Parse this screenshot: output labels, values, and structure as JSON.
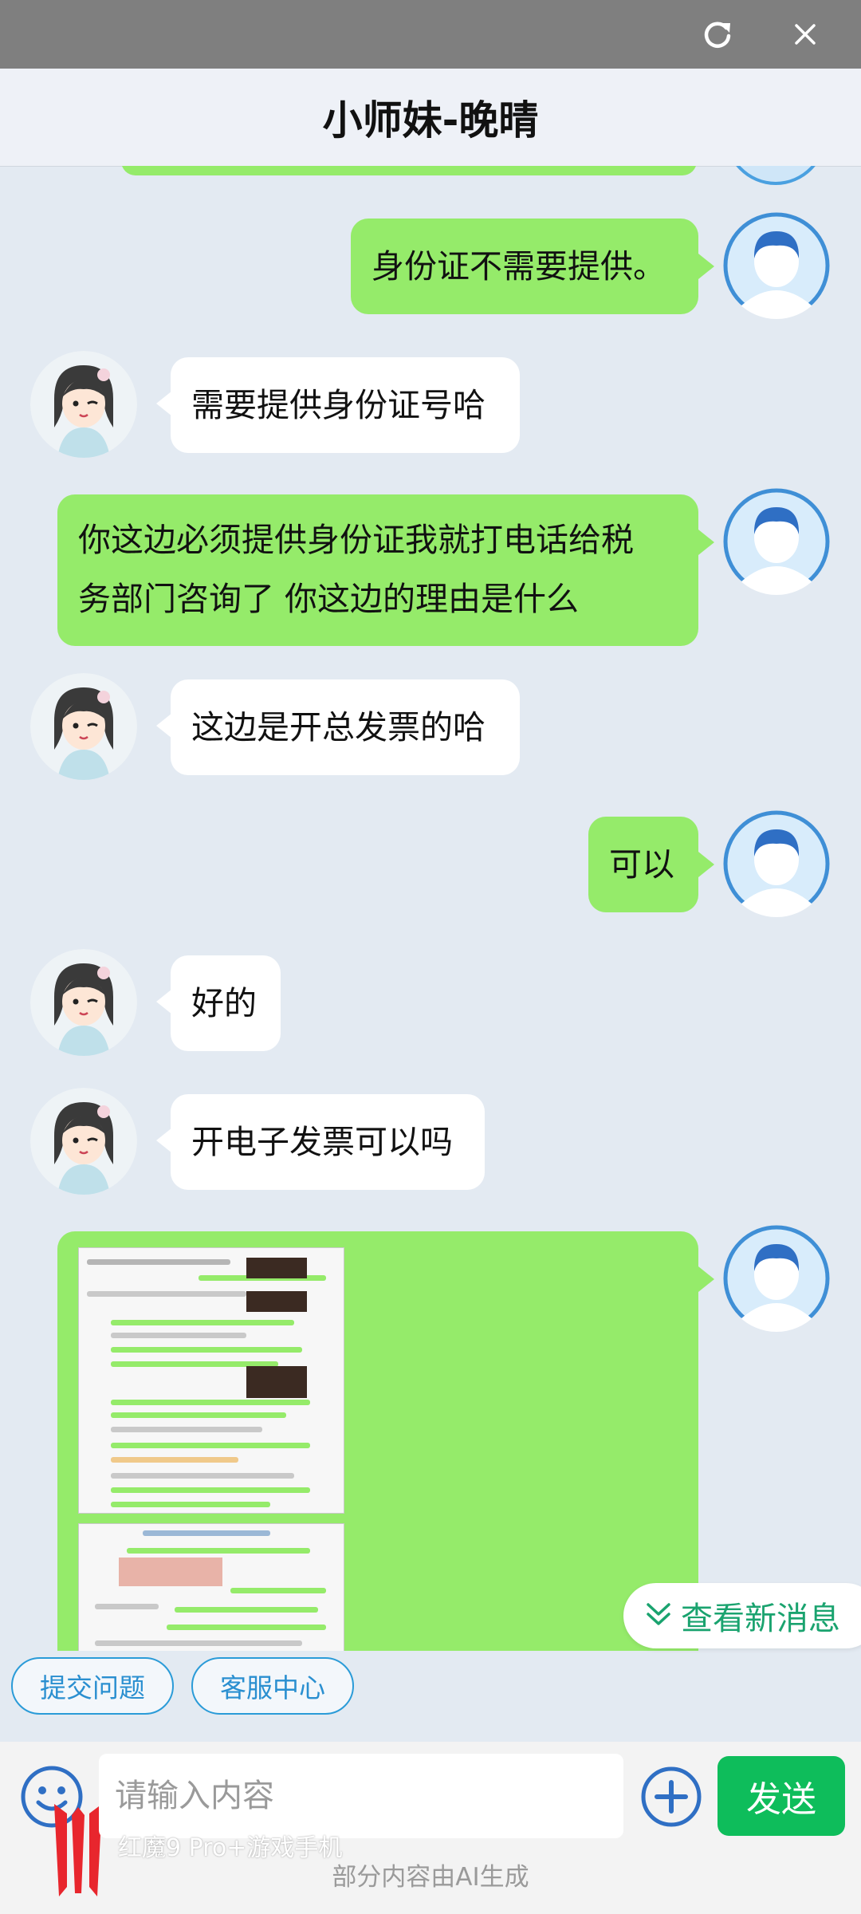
{
  "header": {
    "title": "小师妹-晚晴"
  },
  "messages": [
    {
      "from": "me",
      "text": "身份证不需要提供。"
    },
    {
      "from": "bot",
      "text": "需要提供身份证号哈"
    },
    {
      "from": "me",
      "lines": [
        "你这边必须提供身份证我就打电话给税",
        "务部门咨询了 你这边的理由是什么"
      ]
    },
    {
      "from": "bot",
      "text": "这边是开总发票的哈"
    },
    {
      "from": "me",
      "text": "可以"
    },
    {
      "from": "bot",
      "text": "好的"
    },
    {
      "from": "bot",
      "text": "开电子发票可以吗"
    },
    {
      "from": "me",
      "type": "image"
    }
  ],
  "new_message_button": {
    "label": "查看新消息"
  },
  "quick_actions": {
    "submit": "提交问题",
    "service": "客服中心"
  },
  "input": {
    "placeholder": "请输入内容",
    "send_label": "发送"
  },
  "watermark": "红魔9 Pro+游戏手机",
  "footnote": "部分内容由AI生成",
  "colors": {
    "my_bubble": "#95eb6a",
    "bot_bubble": "#ffffff",
    "send_button": "#0ebd5b",
    "accent_link": "#2a9bd8"
  },
  "icons": [
    "refresh-icon",
    "close-icon",
    "smiley-icon",
    "plus-circle-icon",
    "double-chevron-down-icon",
    "user-avatar-icon",
    "assistant-avatar"
  ]
}
